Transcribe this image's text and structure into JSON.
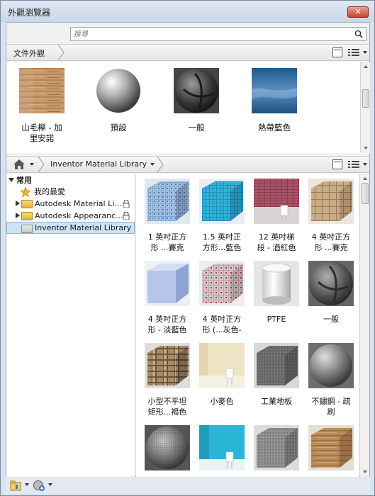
{
  "window": {
    "title": "外觀瀏覽器",
    "close_label": "✕"
  },
  "search": {
    "placeholder": "搜尋",
    "value": ""
  },
  "doc_bar": {
    "crumb": "文件外觀"
  },
  "doc_items": [
    {
      "label": "山毛櫸 - 加\n里安諾",
      "icon": "beech-wood-swatch"
    },
    {
      "label": "預設",
      "icon": "default-sphere"
    },
    {
      "label": "一般",
      "icon": "generic-sphere"
    },
    {
      "label": "熱帶藍色",
      "icon": "tropical-blue-swatch"
    }
  ],
  "library_bar": {
    "crumb": "Inventor Material Library"
  },
  "tree": {
    "root": "常用",
    "items": [
      {
        "label": "我的最愛",
        "icon": "star-icon"
      },
      {
        "label": "Autodesk Material Li...",
        "icon": "folder-icon",
        "locked": true
      },
      {
        "label": "Autodesk Appearanc...",
        "icon": "folder-icon",
        "locked": true
      },
      {
        "label": "Inventor Material Library",
        "icon": "folder-icon",
        "selected": true
      }
    ]
  },
  "materials": [
    {
      "label": "1 英吋正方\n形 ...賽克",
      "icon": "blue-mosaic-tile"
    },
    {
      "label": "1.5 英吋正\n方形...藍色",
      "icon": "cyan-tile"
    },
    {
      "label": "12 英吋梯\n段 - 酒紅色",
      "icon": "wine-red-tile"
    },
    {
      "label": "4 英吋正方\n形 ...賽克",
      "icon": "tan-tile"
    },
    {
      "label": "4 英吋正方\n形 - 淡藍色",
      "icon": "light-blue-cube"
    },
    {
      "label": "4 英吋正方\n形 (...灰色-",
      "icon": "gray-red-tile"
    },
    {
      "label": "PTFE",
      "icon": "ptfe-cylinder"
    },
    {
      "label": "一般",
      "icon": "generic-sphere"
    },
    {
      "label": "小型不平坦\n矩形...褐色",
      "icon": "stone-cube"
    },
    {
      "label": "小麥色",
      "icon": "wheat-wall"
    },
    {
      "label": "工業地板",
      "icon": "industrial-floor"
    },
    {
      "label": "不鏽鋼 - 疏\n刷",
      "icon": "brushed-steel-sphere"
    },
    {
      "label": "",
      "icon": "rough-sphere"
    },
    {
      "label": "",
      "icon": "cyan-wall"
    },
    {
      "label": "",
      "icon": "gray-granite-cube"
    },
    {
      "label": "",
      "icon": "wood-cube"
    }
  ]
}
